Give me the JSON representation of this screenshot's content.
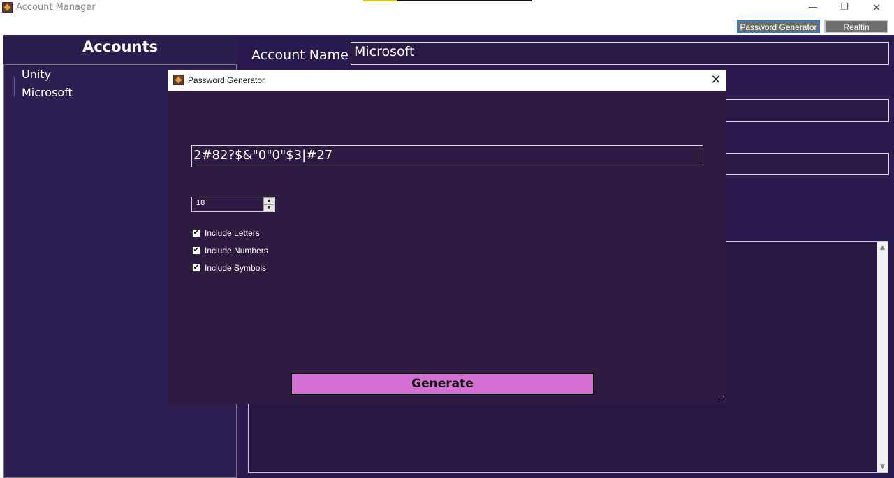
{
  "window": {
    "title": "Account Manager",
    "minimize_glyph": "—",
    "maximize_glyph": "❐",
    "close_glyph": "✕"
  },
  "toolbar": {
    "password_generator_label": "Password Generator",
    "realtin_label": "Realtin"
  },
  "sidebar": {
    "header": "Accounts",
    "items": [
      {
        "label": "Unity"
      },
      {
        "label": "Microsoft"
      }
    ]
  },
  "details": {
    "account_name_label": "Account Name",
    "account_name_value": "Microsoft"
  },
  "dialog": {
    "title": "Password Generator",
    "close_glyph": "✕",
    "password_value": "2#82?$&\"0\"0\"$3|#27",
    "length_value": "18",
    "options": [
      {
        "label": "Include Letters",
        "checked": true
      },
      {
        "label": "Include Numbers",
        "checked": true
      },
      {
        "label": "Include Symbols",
        "checked": true
      }
    ],
    "generate_label": "Generate"
  },
  "colors": {
    "panel_bg": "#2c1d4f",
    "dialog_bg": "#2f1a42",
    "generate_bg": "#d470d4",
    "selected_border": "#2a7ad5"
  }
}
